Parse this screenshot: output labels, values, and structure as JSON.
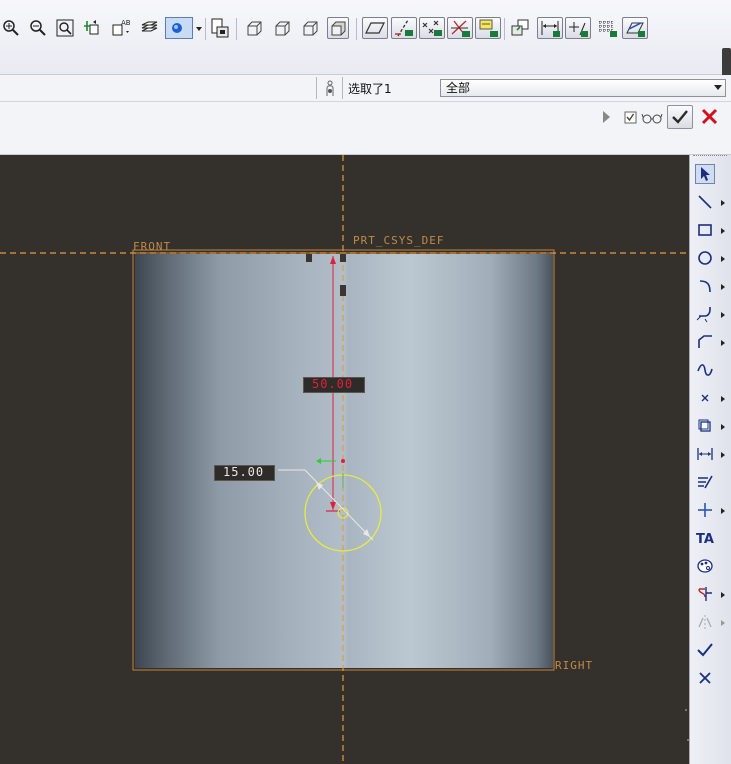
{
  "selection_bar": {
    "selected_text": "选取了1",
    "filter_value": "全部"
  },
  "sketch": {
    "ref_front": "FRONT",
    "ref_csys": "PRT_CSYS_DEF",
    "ref_right": "RIGHT",
    "dim_height": "50.00",
    "dim_diameter": "15.00"
  },
  "colors": {
    "canvas_bg": "#34312d",
    "reference_line": "#e39a3c",
    "dimension_red": "#e0203a",
    "circle_yellow": "#ecec3a",
    "ok_green_check": "#2a2a2a",
    "cancel_red": "#d4101a"
  },
  "icons": {
    "toolbar": [
      "zoom-in-icon",
      "zoom-out-icon",
      "refit-icon",
      "reorient-icon",
      "saved-views-icon",
      "layers-icon",
      "display-style-icon",
      "spin-center-icon",
      "model-tree-icon",
      "shading-wireframe-icon",
      "hidden-line-icon",
      "no-hidden-icon",
      "shaded-icon",
      "plane-display-icon",
      "axis-display-icon",
      "point-display-icon",
      "csys-display-icon",
      "annotation-display-icon",
      "sketch-view-icon",
      "dimension-display-icon",
      "constraint-display-icon",
      "grid-display-icon",
      "vertex-display-icon"
    ],
    "right": [
      "select-icon",
      "line-icon",
      "rectangle-icon",
      "circle-icon",
      "arc-icon",
      "fillet-icon",
      "chamfer-icon",
      "spline-icon",
      "point-icon",
      "use-edge-icon",
      "dimension-icon",
      "modify-icon",
      "constraint-icon",
      "text-icon",
      "palette-icon",
      "trim-icon",
      "mirror-icon",
      "done-check-icon",
      "quit-x-icon"
    ]
  }
}
